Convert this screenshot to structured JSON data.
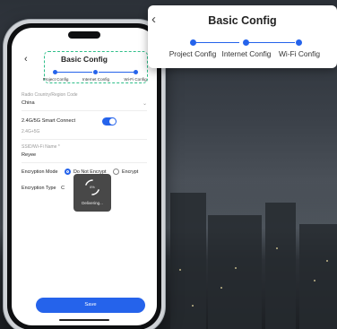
{
  "zoom_panel": {
    "back_icon": "chevron-left-icon",
    "title": "Basic Config",
    "steps": [
      "Project Config",
      "Internet Config",
      "Wi-Fi Config"
    ]
  },
  "phone": {
    "header": {
      "back_icon": "chevron-left-icon",
      "title": "Basic Config",
      "steps": [
        "Project Config",
        "Internet Config",
        "Wi-Fi Config"
      ]
    },
    "form": {
      "country_label": "Radio Country/Region Code",
      "country_value": "China",
      "smart_connect_label": "2.4G/5G Smart Connect",
      "smart_connect_on": true,
      "band_value": "2.4G+5G",
      "ssid_label": "SSID/Wi-Fi Name *",
      "ssid_value": "Reyee",
      "encryption_mode_label": "Encryption Mode",
      "encryption_options": [
        "Do Not Encrypt",
        "Encrypt"
      ],
      "encryption_selected": "Do Not Encrypt",
      "encryption_type_label": "Encryption Type",
      "encryption_type_value": "C"
    },
    "loader": {
      "percent": "6%",
      "text": "Delivering..."
    },
    "save_label": "Save"
  },
  "colors": {
    "accent": "#2563eb",
    "highlight_border": "#2fbf8a"
  }
}
